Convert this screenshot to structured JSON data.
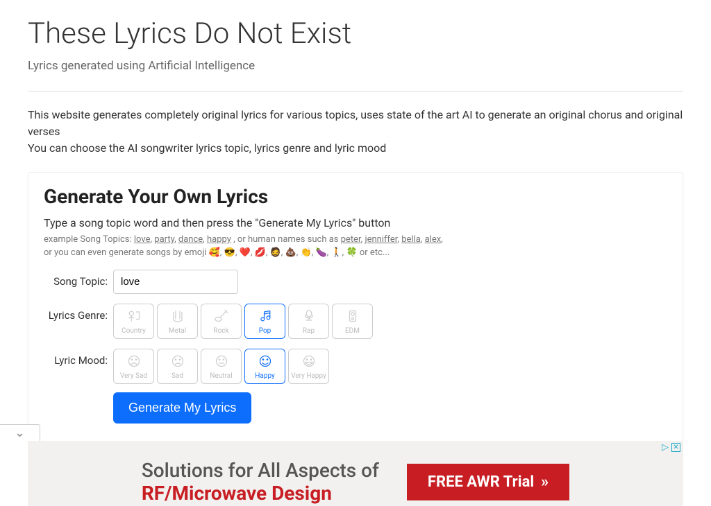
{
  "header": {
    "title": "These Lyrics Do Not Exist",
    "subtitle": "Lyrics generated using Artificial Intelligence"
  },
  "intro": {
    "line1": "This website generates completely original lyrics for various topics, uses state of the art AI to generate an original chorus and original verses",
    "line2": "You can choose the AI songwriter lyrics topic, lyrics genre and lyric mood"
  },
  "card": {
    "title": "Generate Your Own Lyrics",
    "instruction": "Type a song topic word and then press the \"Generate My Lyrics\" button",
    "examples_prefix": "example Song Topics: ",
    "example_topics": [
      "love",
      "party",
      "dance",
      "happy"
    ],
    "examples_mid": ", or human names such as ",
    "example_names": [
      "peter",
      "jenniffer",
      "bella",
      "alex"
    ],
    "emoji_line_prefix": "or you can even generate songs by emoji ",
    "emoji_list": "🥰, 😎, ❤️, 💋, 🧔, 💩, 👏, 🍆, 🚶, 🍀",
    "emoji_line_suffix": " or etc..."
  },
  "form": {
    "topic_label": "Song Topic:",
    "topic_value": "love",
    "genre_label": "Lyrics Genre:",
    "genres": [
      {
        "label": "Country",
        "selected": false,
        "icon": "country"
      },
      {
        "label": "Metal",
        "selected": false,
        "icon": "metal"
      },
      {
        "label": "Rock",
        "selected": false,
        "icon": "rock"
      },
      {
        "label": "Pop",
        "selected": true,
        "icon": "pop"
      },
      {
        "label": "Rap",
        "selected": false,
        "icon": "rap"
      },
      {
        "label": "EDM",
        "selected": false,
        "icon": "edm"
      }
    ],
    "mood_label": "Lyric Mood:",
    "moods": [
      {
        "label": "Very Sad",
        "selected": false,
        "icon": "very-sad"
      },
      {
        "label": "Sad",
        "selected": false,
        "icon": "sad"
      },
      {
        "label": "Neutral",
        "selected": false,
        "icon": "neutral"
      },
      {
        "label": "Happy",
        "selected": true,
        "icon": "happy"
      },
      {
        "label": "Very Happy",
        "selected": false,
        "icon": "very-happy"
      }
    ],
    "generate_label": "Generate My Lyrics"
  },
  "ad": {
    "line1": "Solutions for All Aspects of",
    "line2": "RF/Microwave Design",
    "cta": "FREE AWR Trial",
    "cta_arrow": "»"
  }
}
